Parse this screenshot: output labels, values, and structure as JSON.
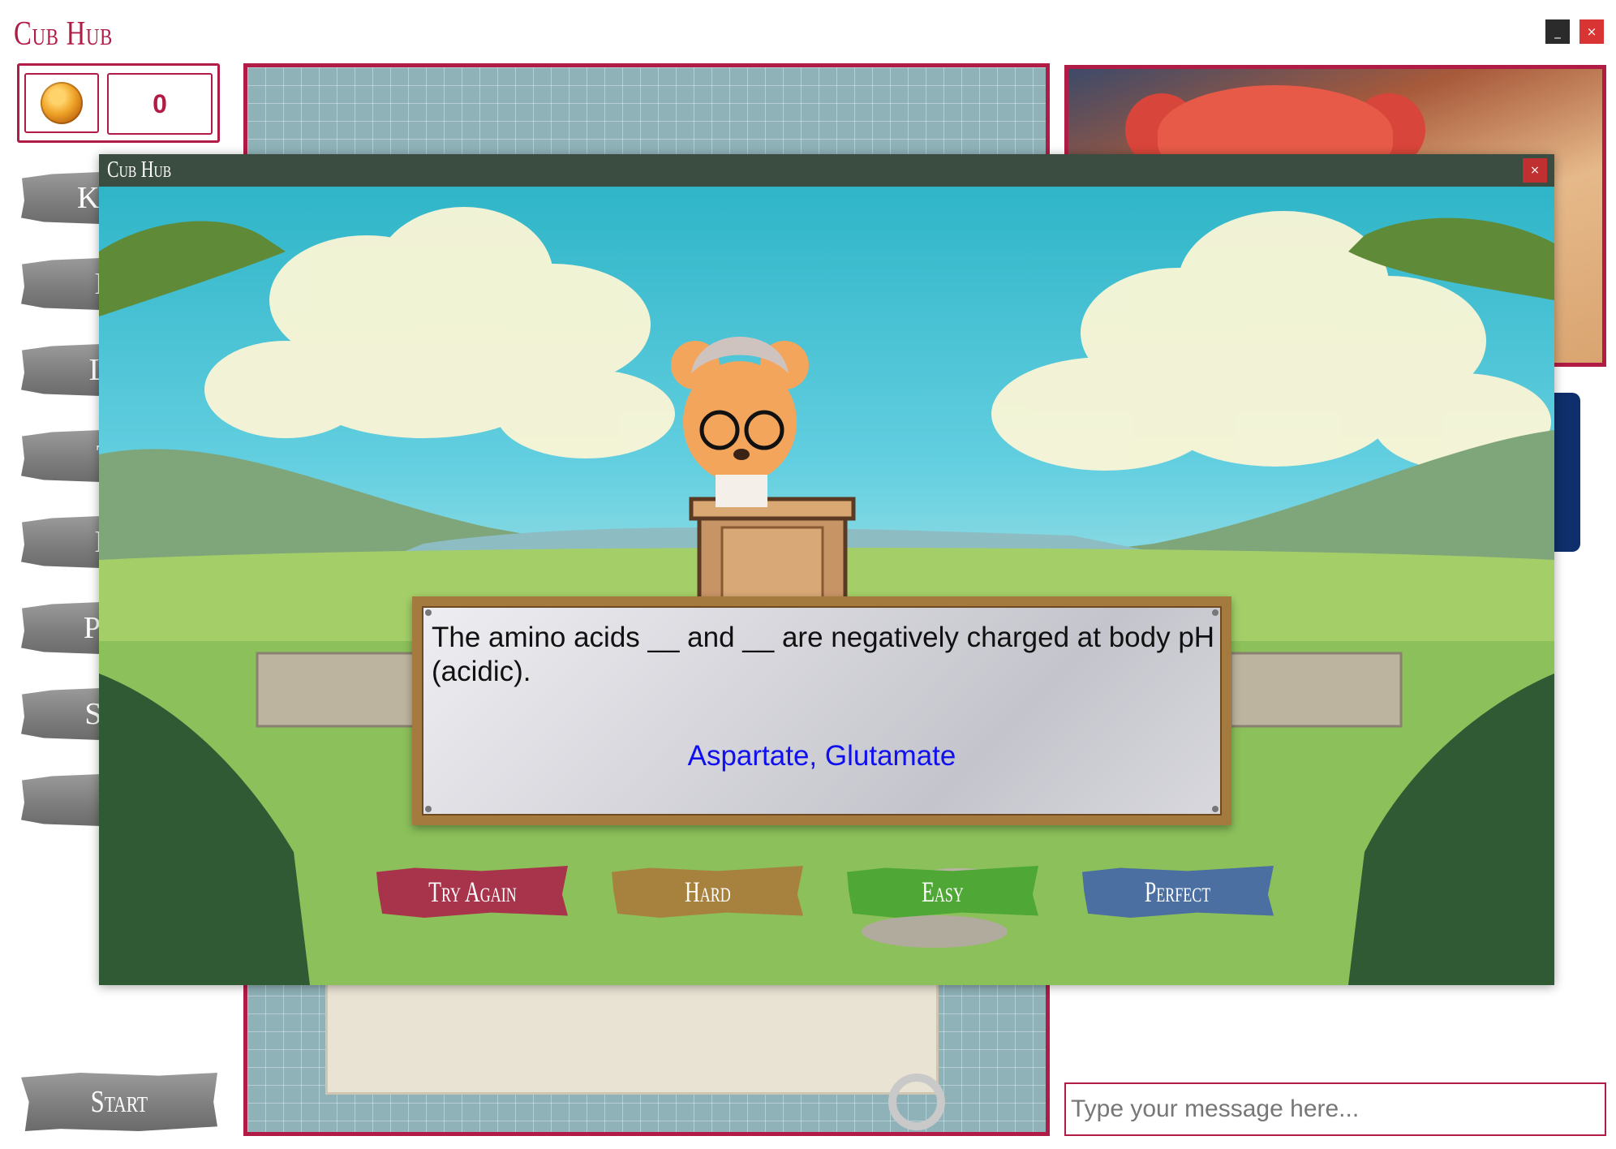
{
  "app": {
    "title": "Cub Hub",
    "minimize_label": "_",
    "close_label": "×"
  },
  "score": {
    "honey_icon": "honeycomb-icon",
    "value": "0"
  },
  "nav": {
    "items": [
      {
        "label": "Kn"
      },
      {
        "label": "B"
      },
      {
        "label": "Li"
      },
      {
        "label": "T"
      },
      {
        "label": "B"
      },
      {
        "label": "Pr"
      },
      {
        "label": "Se"
      },
      {
        "label": ""
      }
    ],
    "start_label": "Start"
  },
  "chat": {
    "placeholder": "Type your message here..."
  },
  "modal": {
    "title": "Cub Hub",
    "close_label": "×",
    "question": "The amino acids __ and __ are negatively charged at body pH (acidic).",
    "answer": "Aspartate, Glutamate",
    "buttons": [
      {
        "label": "Try Again",
        "color": "#a8344c"
      },
      {
        "label": "Hard",
        "color": "#a7823f"
      },
      {
        "label": "Easy",
        "color": "#4fa836"
      },
      {
        "label": "Perfect",
        "color": "#4a6fa0"
      }
    ]
  },
  "colors": {
    "accent": "#b01c45",
    "modal_titlebar": "#3b4d40",
    "answer": "#1010ee",
    "chat_tab": "#0e2f6b"
  }
}
